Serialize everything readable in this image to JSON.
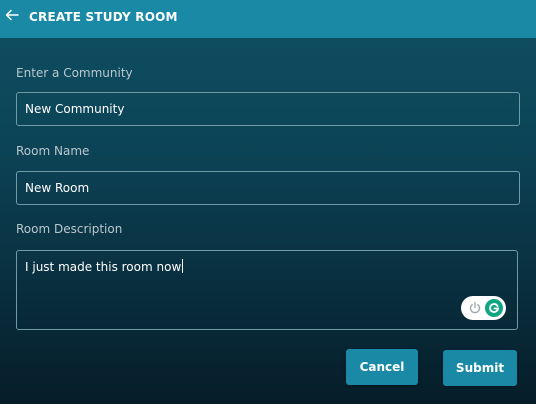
{
  "header": {
    "title": "CREATE STUDY ROOM",
    "back_icon": "arrow-left-icon",
    "color": "#1a89a6"
  },
  "form": {
    "community": {
      "label": "Enter a Community",
      "value": "New Community"
    },
    "room_name": {
      "label": "Room Name",
      "value": "New Room"
    },
    "room_description": {
      "label": "Room Description",
      "value": "I just made this room now"
    }
  },
  "extension": {
    "power_icon": "power-icon",
    "brand_icon": "grammarly-g-icon",
    "brand_color": "#11a683"
  },
  "actions": {
    "cancel_label": "Cancel",
    "submit_label": "Submit"
  }
}
